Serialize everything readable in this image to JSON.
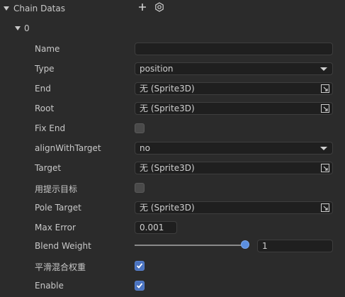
{
  "header": {
    "title": "Chain Datas",
    "add_icon": "plus-icon",
    "settings_icon": "gear-icon"
  },
  "element": {
    "index_label": "0"
  },
  "fields": {
    "name": {
      "label": "Name",
      "value": ""
    },
    "type": {
      "label": "Type",
      "value": "position"
    },
    "end": {
      "label": "End",
      "value": "无 (Sprite3D)"
    },
    "root": {
      "label": "Root",
      "value": "无 (Sprite3D)"
    },
    "fix_end": {
      "label": "Fix End",
      "checked": false
    },
    "align_with_target": {
      "label": "alignWithTarget",
      "value": "no"
    },
    "target": {
      "label": "Target",
      "value": "无 (Sprite3D)"
    },
    "use_hint_target": {
      "label": "用提示目标",
      "checked": false
    },
    "pole_target": {
      "label": "Pole Target",
      "value": "无 (Sprite3D)"
    },
    "max_error": {
      "label": "Max Error",
      "value": "0.001"
    },
    "blend_weight": {
      "label": "Blend Weight",
      "value": "1",
      "slider_fraction": 1.0
    },
    "smooth_blend_weight": {
      "label": "平滑混合权重",
      "checked": true
    },
    "enable": {
      "label": "Enable",
      "checked": true
    }
  },
  "colors": {
    "background": "#2b2b2b",
    "field_bg": "#1f1f1f",
    "checkbox_on": "#4a73c0",
    "slider_knob": "#5b8fe0"
  }
}
